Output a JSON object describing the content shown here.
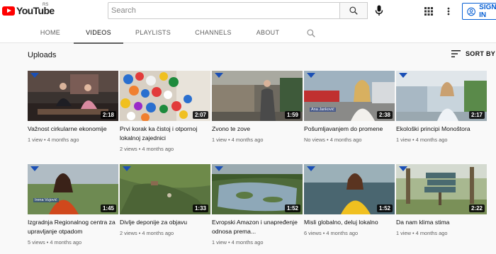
{
  "header": {
    "logo_text": "YouTube",
    "country_code": "RS",
    "search_placeholder": "Search",
    "signin_label": "SIGN IN"
  },
  "tabs": [
    {
      "label": "HOME",
      "active": false
    },
    {
      "label": "VIDEOS",
      "active": true
    },
    {
      "label": "PLAYLISTS",
      "active": false
    },
    {
      "label": "CHANNELS",
      "active": false
    },
    {
      "label": "ABOUT",
      "active": false
    }
  ],
  "section": {
    "title": "Uploads",
    "sort_label": "SORT BY"
  },
  "videos": [
    {
      "title": "Važnost cirkularne ekonomije",
      "views": "1 view",
      "age": "4 months ago",
      "duration": "2:18"
    },
    {
      "title": "Prvi korak ka čistoj i otpornoj lokalnoj zajednici",
      "views": "2 views",
      "age": "4 months ago",
      "duration": "2:07"
    },
    {
      "title": "Zvono te zove",
      "views": "1 view",
      "age": "4 months ago",
      "duration": "1:59"
    },
    {
      "title": "Pošumljavanjem do promene",
      "views": "No views",
      "age": "4 months ago",
      "duration": "2:38"
    },
    {
      "title": "Ekološki principi Monoštora",
      "views": "1 view",
      "age": "4 months ago",
      "duration": "2:17"
    },
    {
      "title": "Izgradnja Regionalnog centra za upravljanje otpadom",
      "views": "5 views",
      "age": "4 months ago",
      "duration": "1:45"
    },
    {
      "title": "Divlje deponije za objavu",
      "views": "2 views",
      "age": "4 months ago",
      "duration": "1:33"
    },
    {
      "title": "Evropski Amazon i unapređenje odnosa prema...",
      "views": "1 view",
      "age": "4 months ago",
      "duration": "1:52"
    },
    {
      "title": "Misli globalno, deluj lokalno",
      "views": "6 views",
      "age": "4 months ago",
      "duration": "1:52"
    },
    {
      "title": "Da nam klima stima",
      "views": "1 view",
      "age": "4 months ago",
      "duration": "2:22"
    }
  ],
  "overlays": {
    "lower_third_1": "Ana Janković",
    "lower_third_2": "Irena Vujović"
  },
  "colors": {
    "brand": "#ff0000",
    "link_blue": "#065fd4",
    "meta_gray": "#606060"
  },
  "icons": [
    "youtube-logo-icon",
    "search-icon",
    "mic-icon",
    "apps-grid-icon",
    "more-vert-icon",
    "account-icon",
    "sort-icon",
    "channel-search-icon"
  ]
}
